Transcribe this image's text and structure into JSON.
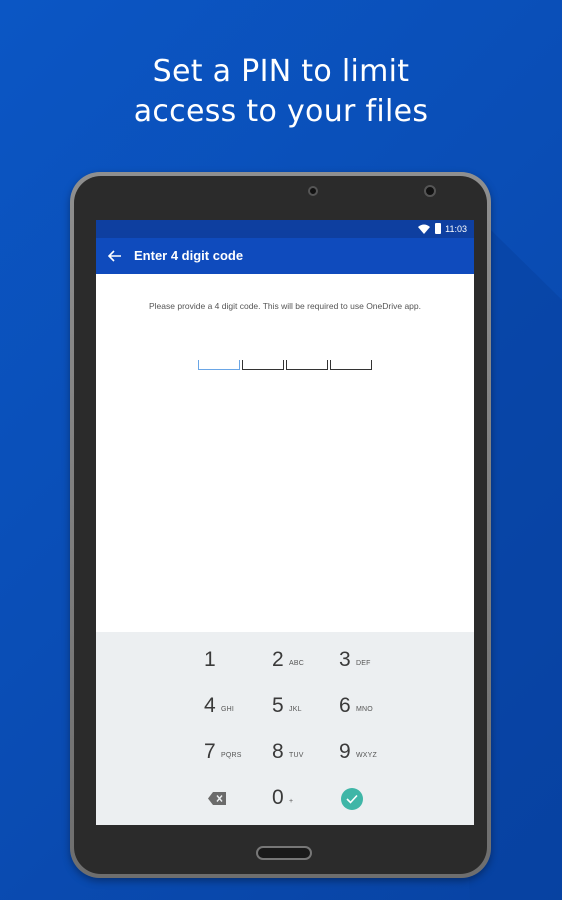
{
  "headline": {
    "line1": "Set a PIN to limit",
    "line2": "access to your files"
  },
  "statusbar": {
    "time": "11:03",
    "icons": [
      "wifi-icon",
      "battery-icon"
    ]
  },
  "appbar": {
    "title": "Enter 4 digit code",
    "back_icon": "arrow-left-icon"
  },
  "instruction": "Please provide a 4 digit code. This will be required to use OneDrive app.",
  "pin": {
    "length": 4,
    "active_index": 0
  },
  "keypad": {
    "keys": [
      {
        "digit": "1",
        "letters": ""
      },
      {
        "digit": "2",
        "letters": "ABC"
      },
      {
        "digit": "3",
        "letters": "DEF"
      },
      {
        "digit": "4",
        "letters": "GHI"
      },
      {
        "digit": "5",
        "letters": "JKL"
      },
      {
        "digit": "6",
        "letters": "MNO"
      },
      {
        "digit": "7",
        "letters": "PQRS"
      },
      {
        "digit": "8",
        "letters": "TUV"
      },
      {
        "digit": "9",
        "letters": "WXYZ"
      },
      {
        "digit": "0",
        "letters": "+"
      }
    ],
    "delete_icon": "backspace-icon",
    "confirm_icon": "check-circle-icon"
  },
  "colors": {
    "background": "#0a4fb8",
    "appbar": "#0f4bbd",
    "statusbar": "#0e3fa0",
    "confirm": "#3fb6a7",
    "active_slot": "#6aa6e6"
  }
}
